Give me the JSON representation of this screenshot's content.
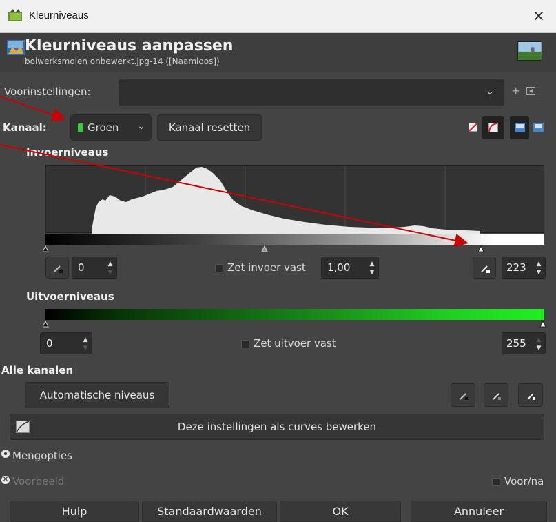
{
  "window": {
    "title": "Kleurniveaus",
    "close": "×"
  },
  "header": {
    "title": "Kleurniveaus aanpassen",
    "subtitle": "bolwerksmolen onbewerkt.jpg-14 ([Naamloos])"
  },
  "presets": {
    "label": "Voorinstellingen:",
    "value": "",
    "add": "+"
  },
  "channel": {
    "label": "Kanaal:",
    "selected": "Groen",
    "dot_color": "#3ec83e",
    "reset_label": "Kanaal resetten"
  },
  "input_levels": {
    "title": "Invoerniveaus",
    "low_value": "0",
    "gamma_label": "Zet invoer vast",
    "gamma_value": "1,00",
    "high_value": "223",
    "marker_fractions": [
      0.0,
      0.44,
      0.875
    ]
  },
  "output_levels": {
    "title": "Uitvoerniveaus",
    "low_value": "0",
    "clamp_label": "Zet uitvoer vast",
    "high_value": "255"
  },
  "all_channels": {
    "title": "Alle kanalen",
    "auto_label": "Automatische niveaus"
  },
  "curves": {
    "label": "Deze instellingen als curves bewerken"
  },
  "blend": {
    "label": "Mengopties"
  },
  "preview": {
    "label": "Voorbeeld",
    "split_label": "Voor/na"
  },
  "footer": {
    "help": "Hulp",
    "defaults": "Standaardwaarden",
    "ok": "OK",
    "cancel": "Annuleer"
  },
  "colors": {
    "accent_green": "#22ee22",
    "arrow": "#cc0000"
  }
}
